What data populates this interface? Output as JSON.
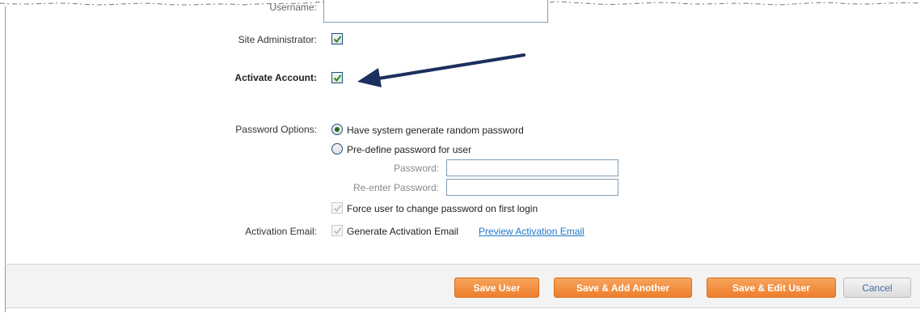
{
  "form": {
    "username_label": "Username:",
    "site_admin_label": "Site Administrator:",
    "activate_account_label": "Activate Account:",
    "password_options_label": "Password Options:",
    "password_options": {
      "generate_label": "Have system generate random password",
      "predefine_label": "Pre-define password for user",
      "password_label": "Password:",
      "reenter_label": "Re-enter Password:",
      "password_value": "",
      "reenter_value": "",
      "force_change_label": "Force user to change password on first login"
    },
    "activation_email_label": "Activation Email:",
    "generate_activation_label": "Generate Activation Email",
    "preview_link": "Preview Activation Email"
  },
  "footer": {
    "save_user": "Save User",
    "save_add_another": "Save & Add Another",
    "save_edit_user": "Save & Edit User",
    "cancel": "Cancel"
  },
  "colors": {
    "button_orange": "#ee7f2d",
    "arrow": "#1c2f5e",
    "link": "#1f78c8",
    "check": "#2b8a1f"
  },
  "icons": [
    "checkbox-checked-icon",
    "radio-selected-icon",
    "radio-empty-icon",
    "annotation-arrow-icon"
  ]
}
